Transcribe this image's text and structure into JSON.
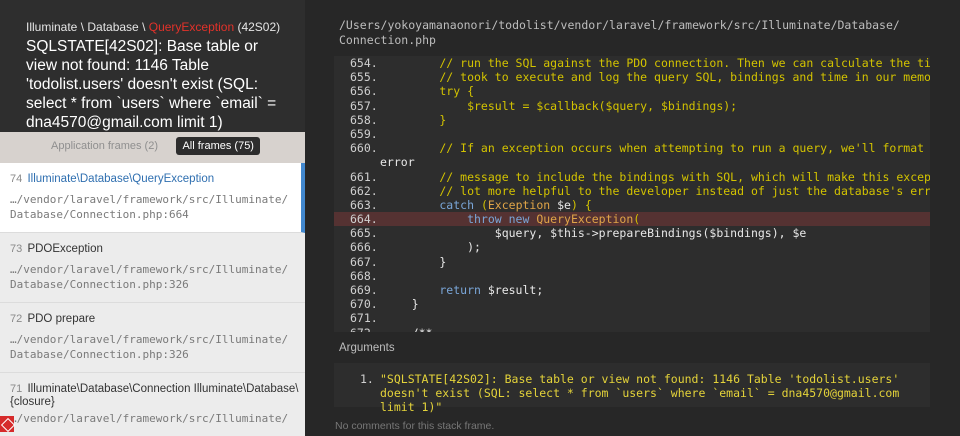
{
  "header": {
    "crumb_ns": "Illuminate \\ Database \\ ",
    "crumb_exception": "QueryException",
    "crumb_code": " (42S02)",
    "message": "SQLSTATE[42S02]: Base table or view not found: 1146 Table 'todolist.users' doesn't exist (SQL: select * from `users` where `email` = dna4570@gmail.com limit 1)"
  },
  "filters": {
    "application": "Application frames (2)",
    "all": "All frames (75)"
  },
  "frames": [
    {
      "num": "74",
      "cls": "Illuminate\\Database\\QueryException",
      "path1": "…/vendor/laravel/framework/src/Illuminate/",
      "path2": "Database/Connection.php:664"
    },
    {
      "num": "73",
      "cls": "PDOException",
      "path1": "…/vendor/laravel/framework/src/Illuminate/",
      "path2": "Database/Connection.php:326"
    },
    {
      "num": "72",
      "cls": "PDO prepare",
      "path1": "…/vendor/laravel/framework/src/Illuminate/",
      "path2": "Database/Connection.php:326"
    },
    {
      "num": "71",
      "cls": "Illuminate\\Database\\Connection Illuminate\\Database\\",
      "cls2": "{closure}",
      "path1": "…/vendor/laravel/framework/src/Illuminate/"
    }
  ],
  "file_path": "/Users/yokoyamanaonori/todolist/vendor/laravel/framework/src/Illuminate/Database/",
  "file_name": "Connection.php",
  "code": {
    "lines": [
      {
        "n": "654.",
        "parts": [
          [
            "c",
            "        // run the SQL against the PDO connection. Then we can calculate the time it"
          ]
        ]
      },
      {
        "n": "655.",
        "parts": [
          [
            "c",
            "        // took to execute and log the query SQL, bindings and time in our memory."
          ]
        ]
      },
      {
        "n": "656.",
        "parts": [
          [
            "c",
            "        try {"
          ]
        ]
      },
      {
        "n": "657.",
        "parts": [
          [
            "c",
            "            $result = $callback($query, $bindings);"
          ]
        ]
      },
      {
        "n": "658.",
        "parts": [
          [
            "c",
            "        }"
          ]
        ]
      },
      {
        "n": "659.",
        "parts": [
          [
            "v",
            ""
          ]
        ]
      },
      {
        "n": "660.",
        "parts": [
          [
            "c",
            "        // If an exception occurs when attempting to run a query, we'll format the"
          ]
        ]
      },
      {
        "n": "",
        "cont": "error"
      },
      {
        "n": "661.",
        "parts": [
          [
            "c",
            "        // message to include the bindings with SQL, which will make this exception a"
          ]
        ]
      },
      {
        "n": "662.",
        "parts": [
          [
            "c",
            "        // lot more helpful to the developer instead of just the database's errors."
          ]
        ]
      },
      {
        "n": "663.",
        "parts": [
          [
            "k",
            "        catch "
          ],
          [
            "c",
            "("
          ],
          [
            "t",
            "Exception "
          ],
          [
            "v",
            "$e"
          ],
          [
            "c",
            ") {"
          ]
        ]
      },
      {
        "n": "664.",
        "hl": true,
        "parts": [
          [
            "k",
            "            throw new "
          ],
          [
            "t",
            "QueryException"
          ],
          [
            "c",
            "("
          ]
        ]
      },
      {
        "n": "665.",
        "parts": [
          [
            "v",
            "                $query, $this->prepareBindings($bindings), $e"
          ]
        ]
      },
      {
        "n": "666.",
        "parts": [
          [
            "v",
            "            );"
          ]
        ]
      },
      {
        "n": "667.",
        "parts": [
          [
            "v",
            "        }"
          ]
        ]
      },
      {
        "n": "668.",
        "parts": [
          [
            "v",
            ""
          ]
        ]
      },
      {
        "n": "669.",
        "parts": [
          [
            "k",
            "        return "
          ],
          [
            "v",
            "$result;"
          ]
        ]
      },
      {
        "n": "670.",
        "parts": [
          [
            "v",
            "    }"
          ]
        ]
      },
      {
        "n": "671.",
        "parts": [
          [
            "v",
            ""
          ]
        ]
      },
      {
        "n": "672.",
        "parts": [
          [
            "v",
            "    /**"
          ]
        ]
      }
    ]
  },
  "arguments": {
    "title": "Arguments",
    "items": [
      {
        "n": "1.",
        "value": "\"SQLSTATE[42S02]: Base table or view not found: 1146 Table 'todolist.users' doesn't exist (SQL: select * from `users` where `email` = dna4570@gmail.com limit 1)\""
      }
    ]
  },
  "no_comments": "No comments for this stack frame."
}
